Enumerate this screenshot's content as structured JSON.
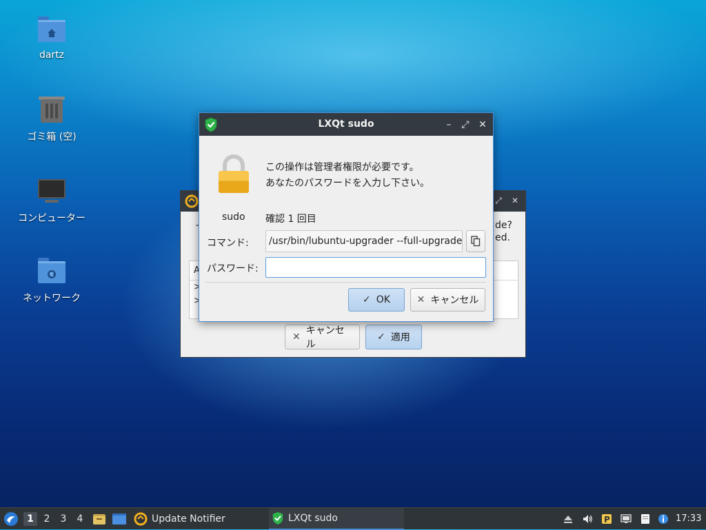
{
  "desktop": {
    "icons": [
      {
        "label": "dartz"
      },
      {
        "label": "ゴミ箱 (空)"
      },
      {
        "label": "コンピューター"
      },
      {
        "label": "ネットワーク"
      }
    ]
  },
  "background_window": {
    "right_text_line1": "de?",
    "right_text_line2": "ed.",
    "left_text": "-",
    "tree_header": "A",
    "tree_rows": [
      ">",
      ">"
    ],
    "cancel_label": "キャンセル",
    "apply_label": "適用"
  },
  "dialog": {
    "title": "LXQt sudo",
    "message_line1": "この操作は管理者権限が必要です。",
    "message_line2": "あなたのパスワードを入力し下さい。",
    "user_label": "sudo",
    "attempt_text": "確認 1 回目",
    "command_label": "コマンド:",
    "command_value": "/usr/bin/lubuntu-upgrader --full-upgrade",
    "password_label": "パスワード:",
    "password_value": "",
    "ok_label": "OK",
    "cancel_label": "キャンセル",
    "minimize_glyph": "–",
    "maximize_glyph": "⤢",
    "close_glyph": "✕"
  },
  "taskbar": {
    "desktops": [
      "1",
      "2",
      "3",
      "4"
    ],
    "active_desktop": "1",
    "tasks": [
      {
        "label": "Update Notifier",
        "active": false
      },
      {
        "label": "LXQt sudo",
        "active": true
      }
    ],
    "clock": "17:33"
  },
  "colors": {
    "titlebar": "#333a41",
    "accent": "#4a90d9",
    "shield_green": "#2fb24a",
    "lock_gold": "#f7c64a",
    "taskbar": "#2f3438"
  },
  "icons": {
    "home_folder": "home-folder-icon",
    "trash": "trash-icon",
    "computer": "computer-icon",
    "network": "network-folder-icon",
    "shield": "shield-check-icon",
    "lock": "padlock-icon",
    "copy": "copy-icon"
  }
}
